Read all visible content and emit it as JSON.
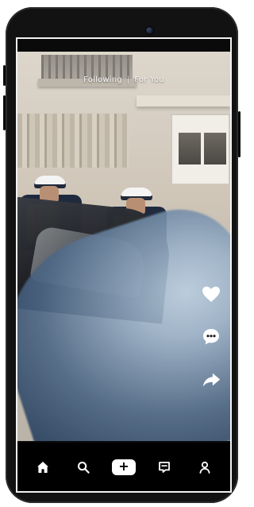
{
  "tabs": {
    "following": "Following",
    "separator": "|",
    "for_you": "For You"
  },
  "actions": {
    "like_icon": "heart-icon",
    "comment_icon": "comment-icon",
    "share_icon": "share-icon"
  },
  "bottom_nav": {
    "home_icon": "home-icon",
    "search_icon": "search-icon",
    "create_icon": "plus-icon",
    "create_plus": "+",
    "inbox_icon": "inbox-icon",
    "profile_icon": "profile-icon"
  }
}
